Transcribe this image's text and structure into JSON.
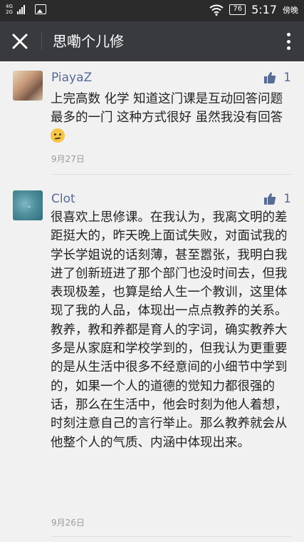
{
  "status_bar": {
    "network_top": "4G",
    "network_bottom": "2G",
    "battery": "76",
    "time": "5:17",
    "time_suffix": "傍晚",
    "icons": [
      "signal-icon",
      "image-notification-icon",
      "wifi-icon",
      "battery-icon"
    ]
  },
  "header": {
    "title": "思嘞个儿修",
    "close_icon": "close-icon",
    "more_icon": "more-vertical-icon"
  },
  "comments": [
    {
      "name": "PiayaZ",
      "likes": "1",
      "text": "上完高数 化学 知道这门课是互动回答问题最多的一门 这种方式很好 虽然我没有回答",
      "emoji": "embarrassed-emoji",
      "date": "9月27日"
    },
    {
      "name": "Clot",
      "likes": "1",
      "text": "很喜欢上思修课。在我认为，我离文明的差距挺大的，昨天晚上面试失败，对面试我的学长学姐说的话刻薄，甚至嚣张，我明白我进了创新班进了那个部门也没时间去，但我表现极差，也算是给人生一个教训，这里体现了我的人品，体现出一点点教养的关系。教养，教和养都是育人的字词，确实教养大多是从家庭和学校学到的，但我认为更重要的是从生活中很多不经意间的小细节中学到的，如果一个人的道德的觉知力都很强的话，那么在生活中，他会时刻为他人着想，时刻注意自己的言行举止。那么教养就会从他整个人的气质、内涵中体现出来。",
      "date": "9月26日"
    }
  ],
  "colors": {
    "status_bar": "#2b2b2b",
    "app_bar": "#393a3f",
    "background": "#f1f1f1",
    "name": "#576b95",
    "date": "#9a9a9a"
  }
}
